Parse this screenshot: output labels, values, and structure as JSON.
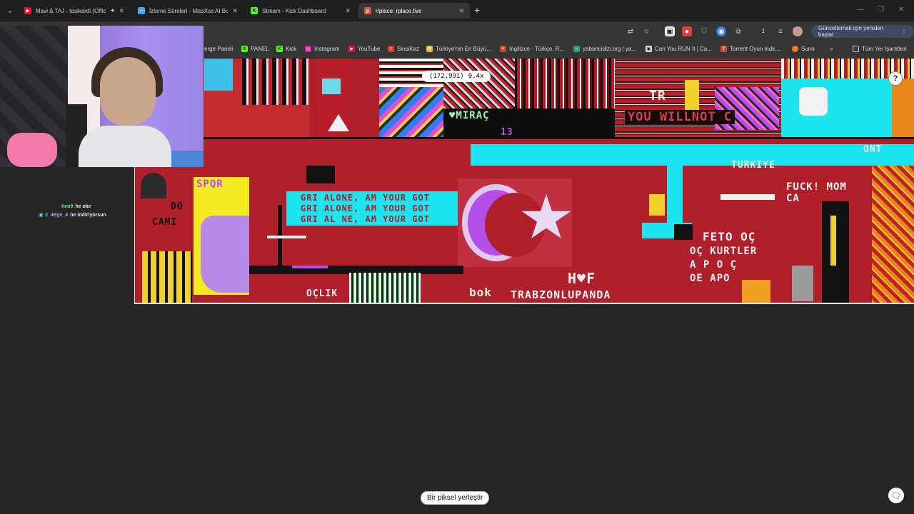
{
  "tabs": [
    {
      "title": "Mavi & TAJ - tasikardi (Offic",
      "favicon": "youtube-icon",
      "color": "#ff0033",
      "active": false
    },
    {
      "title": "İzleme Süreleri - MissXss AI Bo",
      "favicon": "fish-icon",
      "color": "#3fa9f5",
      "active": false
    },
    {
      "title": "Stream - Kick Dashboard",
      "favicon": "kick-icon",
      "color": "#53fc18",
      "active": false
    },
    {
      "title": "r/place: rplace.live",
      "favicon": "rplace-icon",
      "color": "#e0523d",
      "active": true
    }
  ],
  "toolbar": {
    "update_label": "Güncellemek için yeniden başlat"
  },
  "bookmarks": [
    {
      "label": "erge Paneli",
      "icon": "none",
      "color": "#353535"
    },
    {
      "label": "PANEL",
      "icon": "kick-icon",
      "color": "#53fc18"
    },
    {
      "label": "Kick",
      "icon": "kick-icon",
      "color": "#53fc18"
    },
    {
      "label": "Instagram",
      "icon": "instagram-icon",
      "color": "#d6249f"
    },
    {
      "label": "YouTube",
      "icon": "youtube-icon",
      "color": "#ff0033"
    },
    {
      "label": "SinsiKaz",
      "icon": "bookmark-icon",
      "color": "#e03a3a"
    },
    {
      "label": "Türkiye'nin En Büyü...",
      "icon": "bookmark-icon",
      "color": "#e8b63a"
    },
    {
      "label": "Ingilizce - Türkçe, R...",
      "icon": "bookmark-icon",
      "color": "#c8462e"
    },
    {
      "label": "yabancidizi.org | ya...",
      "icon": "bookmark-icon",
      "color": "#2fa36b"
    },
    {
      "label": "Can You RUN It | Ca...",
      "icon": "bookmark-icon",
      "color": "#dddddd"
    },
    {
      "label": "Torrent Oyun indir,...",
      "icon": "bookmark-icon",
      "color": "#d24a2b"
    },
    {
      "label": "Suno",
      "icon": "bookmark-icon",
      "color": "#f07a2e"
    }
  ],
  "bookmarks_overflow": "»",
  "all_bookmarks_label": "Tüm Yer İşaretleri",
  "chat": [
    {
      "user": "heo9",
      "message": "he oke",
      "user_color": "#7ee07e"
    },
    {
      "user": "4Ege_4",
      "message": "ne indiriyorsun",
      "user_color": "#c98af0"
    }
  ],
  "canvas": {
    "coords": "(172,991)",
    "zoom": "0.4x",
    "texts": {
      "mirac": "♥MIRAÇ",
      "num13": "13",
      "youwillnot": "YOU WILLNOT C",
      "tr": "TR",
      "spqr": "SPQR",
      "don": "DO",
      "cami": "CAMI",
      "gri1": "GRI ALONE, AM YOUR GOT",
      "gri2": "GRI ALONE, AM YOUR GOT",
      "gri3": "GRI AL NE, AM YOUR GOT",
      "fuckmom": "FUCK! MOM",
      "ca": "CA",
      "turkiye": "TURKIYE",
      "feto": "FETO OÇ",
      "kurtler": "OÇ KURTLER",
      "apo": "A P O Ç",
      "oeapo": "OE APO",
      "hof": "H♥F",
      "bok": "bok",
      "trabzon": "TRABZONLUPANDA",
      "oclik": "OÇLIK",
      "ont": "ONT"
    }
  },
  "place_button": "Bir piksel yerleştir",
  "colors": {
    "canvas_red": "#b01f2a",
    "cyan": "#1ce5f0",
    "purple": "#b44ee8"
  }
}
